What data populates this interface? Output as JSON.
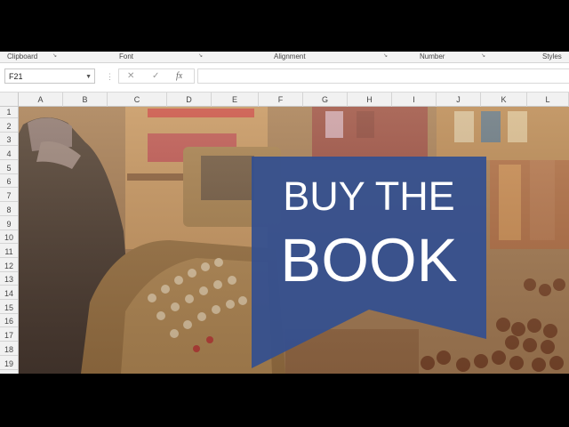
{
  "ribbon": {
    "groups": [
      {
        "label": "Clipboard"
      },
      {
        "label": "Font"
      },
      {
        "label": "Alignment"
      },
      {
        "label": "Number"
      },
      {
        "label": "Styles"
      }
    ]
  },
  "formula_bar": {
    "name_box": "F21",
    "cancel_symbol": "✕",
    "enter_symbol": "✓",
    "function_symbol": "fx",
    "formula": ""
  },
  "columns": [
    "A",
    "B",
    "C",
    "D",
    "E",
    "F",
    "G",
    "H",
    "I",
    "J",
    "K",
    "L"
  ],
  "rows": [
    "1",
    "2",
    "3",
    "4",
    "5",
    "6",
    "7",
    "8",
    "9",
    "10",
    "11",
    "12",
    "13",
    "14",
    "15",
    "16",
    "17",
    "18",
    "19"
  ],
  "banner": {
    "line1": "BUY THE",
    "line2": "BOOK",
    "color": "#34508f"
  },
  "colors": {
    "header_bg": "#f1f1f1",
    "ribbon_bg": "#f3f3f3"
  }
}
